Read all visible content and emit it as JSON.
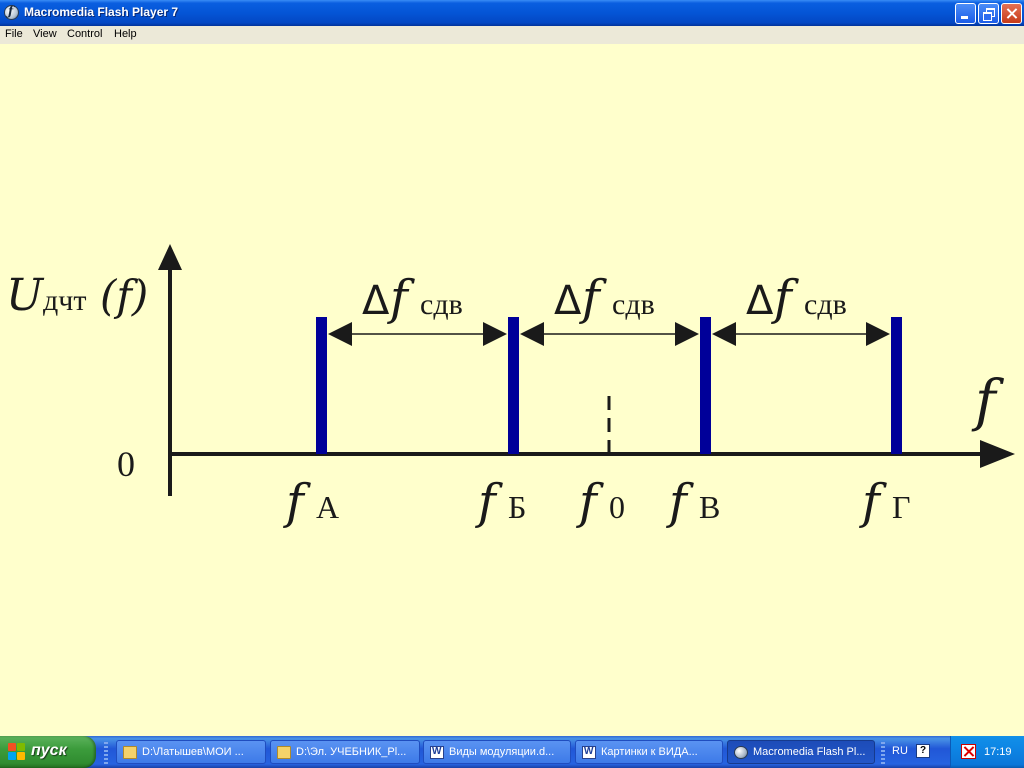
{
  "window": {
    "title": "Macromedia Flash Player 7"
  },
  "menu": {
    "items": [
      "File",
      "View",
      "Control",
      "Help"
    ]
  },
  "slide": {
    "y_axis_label_main": "U",
    "y_axis_label_sub": "дчт",
    "y_axis_label_arg": "(f)",
    "x_axis_label": "f",
    "origin_label": "0",
    "delta_symbol": "Δ",
    "delta_var": "f",
    "delta_sub": "сдв",
    "tick_main": "f",
    "ticks": [
      {
        "sub": "А"
      },
      {
        "sub": "Б"
      },
      {
        "sub": "0"
      },
      {
        "sub": "В"
      },
      {
        "sub": "Г"
      }
    ],
    "colors": {
      "background": "#ffffcc",
      "axis": "#1a1a1a",
      "spectral_line": "#000099"
    }
  },
  "taskbar": {
    "start_label": "пуск",
    "tasks": [
      {
        "label": "D:\\Латышев\\МОИ ...",
        "icon": "folder-icon"
      },
      {
        "label": "D:\\Эл. УЧЕБНИК_Pl...",
        "icon": "folder-icon"
      },
      {
        "label": "Виды модуляции.d...",
        "icon": "word-icon"
      },
      {
        "label": "Картинки к ВИДА...",
        "icon": "word-icon"
      },
      {
        "label": "Macromedia Flash Pl...",
        "icon": "flash-icon",
        "active": true
      }
    ],
    "language": "RU",
    "help_glyph": "?",
    "clock": "17:19"
  }
}
